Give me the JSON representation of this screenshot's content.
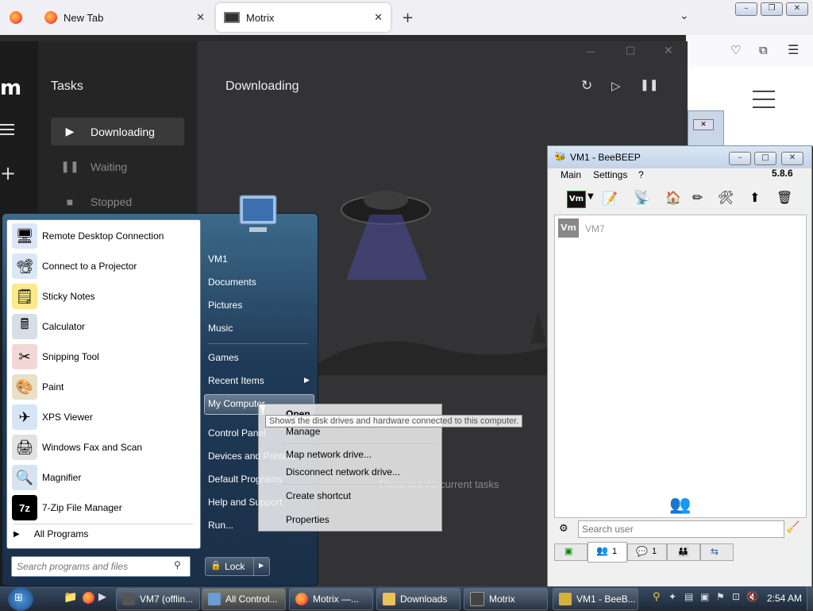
{
  "firefox": {
    "tabs": [
      {
        "label": "New Tab"
      },
      {
        "label": "Motrix"
      }
    ],
    "new_tab_glyph": "+"
  },
  "motrix": {
    "logo": "m",
    "sidebar_title": "Tasks",
    "nav": [
      {
        "label": "Downloading"
      },
      {
        "label": "Waiting"
      },
      {
        "label": "Stopped"
      }
    ],
    "main_title": "Downloading",
    "empty_message": "There are no current tasks"
  },
  "start_menu": {
    "programs": [
      {
        "label": "Remote Desktop Connection",
        "icon": "remote-desktop-icon"
      },
      {
        "label": "Connect to a Projector",
        "icon": "projector-icon"
      },
      {
        "label": "Sticky Notes",
        "icon": "sticky-notes-icon"
      },
      {
        "label": "Calculator",
        "icon": "calculator-icon"
      },
      {
        "label": "Snipping Tool",
        "icon": "snipping-tool-icon"
      },
      {
        "label": "Paint",
        "icon": "paint-icon"
      },
      {
        "label": "XPS Viewer",
        "icon": "xps-viewer-icon"
      },
      {
        "label": "Windows Fax and Scan",
        "icon": "fax-icon"
      },
      {
        "label": "Magnifier",
        "icon": "magnifier-icon"
      },
      {
        "label": "7-Zip File Manager",
        "icon": "7zip-icon"
      }
    ],
    "all_programs": "All Programs",
    "search_placeholder": "Search programs and files",
    "right_items": [
      {
        "label": "VM1"
      },
      {
        "label": "Documents"
      },
      {
        "label": "Pictures"
      },
      {
        "label": "Music"
      },
      {
        "label": "Games"
      },
      {
        "label": "Recent Items"
      },
      {
        "label": "My Computer"
      },
      {
        "label": "Control Panel"
      },
      {
        "label": "Devices and Printers"
      },
      {
        "label": "Default Programs"
      },
      {
        "label": "Help and Support"
      },
      {
        "label": "Run..."
      }
    ],
    "lock_label": "Lock",
    "tooltip": "Shows the disk drives and hardware connected to this computer."
  },
  "context_menu": {
    "items": [
      {
        "label": "Open"
      },
      {
        "label": "Manage"
      },
      {
        "label": "Map network drive..."
      },
      {
        "label": "Disconnect network drive..."
      },
      {
        "label": "Create shortcut"
      },
      {
        "label": "Properties"
      }
    ]
  },
  "beebeep": {
    "title": "VM1 - BeeBEEP",
    "menu": [
      "Main",
      "Settings",
      "?"
    ],
    "version": "5.8.6",
    "user_badge": "Vm",
    "user_name": "VM7",
    "search_placeholder": "Search user",
    "tab_counts": [
      "1",
      "1"
    ]
  },
  "taskbar": {
    "buttons": [
      {
        "label": "VM7 (offlin..."
      },
      {
        "label": "All Control..."
      },
      {
        "label": "Motrix —..."
      },
      {
        "label": "Downloads"
      },
      {
        "label": "Motrix"
      },
      {
        "label": "VM1 - BeeB..."
      }
    ],
    "clock": "2:54 AM"
  },
  "colors": {
    "motrix_bg": "#333335",
    "start_menu_blue": "#1f3a57",
    "taskbar": "#1c2838"
  }
}
